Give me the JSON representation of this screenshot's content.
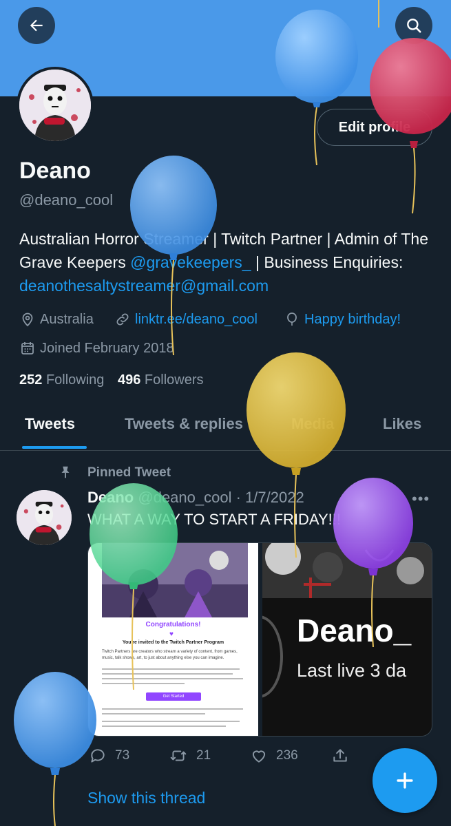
{
  "header": {
    "back_icon": "arrow-left-icon",
    "search_icon": "search-icon",
    "banner_color": "#4a99e9"
  },
  "profile": {
    "edit_label": "Edit profile",
    "name": "Deano",
    "handle": "@deano_cool",
    "bio_text_1": "Australian Horror Streamer | Twitch Partner | Admin of The Grave Keepers ",
    "bio_link_1": "@gravekeepers_",
    "bio_text_2": " | Business Enquiries: ",
    "bio_link_2": "deanothesaltystreamer@gmail.com",
    "location": "Australia",
    "website": "linktr.ee/deano_cool",
    "birthday": "Happy birthday!",
    "joined": "Joined February 2018",
    "following_count": "252",
    "following_label": "Following",
    "followers_count": "496",
    "followers_label": "Followers"
  },
  "tabs": [
    "Tweets",
    "Tweets & replies",
    "Media",
    "Likes"
  ],
  "tweet": {
    "pinned_label": "Pinned Tweet",
    "name": "Deano",
    "handle": "@deano_cool",
    "separator": " · ",
    "date": "1/7/2022",
    "more": "•••",
    "text": "WHAT A WAY TO START A FRIDAY!!!",
    "image1": {
      "congrats": "Congratulations!",
      "invite": "You're invited to the Twitch Partner Program",
      "body": "Twitch Partners are creators who stream a variety of content, from games, music, talk shows, art, to just about anything else you can imagine.",
      "button": "Get Started"
    },
    "image2": {
      "title": "Deano_",
      "subtitle": "Last live 3 da"
    },
    "replies": "73",
    "retweets": "21",
    "likes": "236",
    "show_thread": "Show this thread"
  },
  "fab_icon": "plus-icon",
  "colors": {
    "accent": "#1d9bf0",
    "background": "#15202b",
    "muted": "#8b98a5",
    "twitch_purple": "#9146ff"
  }
}
